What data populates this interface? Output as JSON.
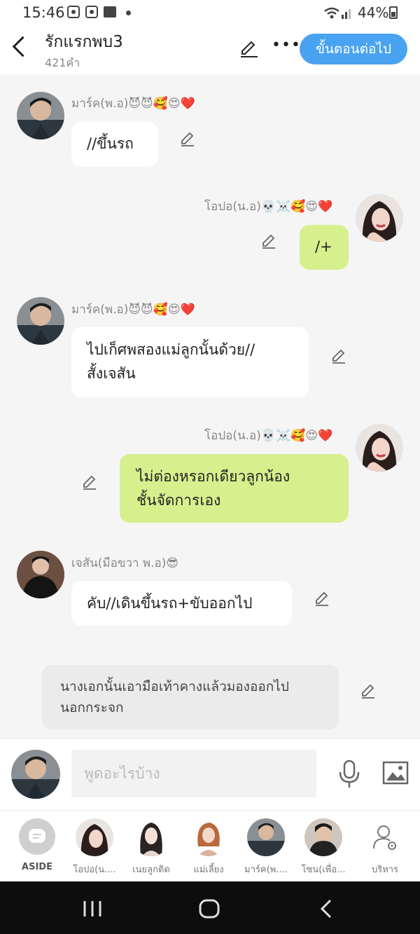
{
  "status_bar": {
    "time": "15:46",
    "battery": "44%"
  },
  "header": {
    "title": "รักแรกพบ3",
    "subtitle": "421คำ",
    "next_button": "ขั้นตอนต่อไป"
  },
  "messages": [
    {
      "sender": "มาร์ค(พ.อ)😈😈🥰😍❤️",
      "text": "//ขึ้นรถ",
      "side": "left"
    },
    {
      "sender": "โอปอ(น.อ)💀☠️🥰😍❤️",
      "text": "/+",
      "side": "right"
    },
    {
      "sender": "มาร์ค(พ.อ)😈😈🥰😍❤️",
      "text_lines": [
        "ไปเก็ศพสองแม่ลูกนั้นด้วย//",
        "สั้งเจสัน"
      ],
      "side": "left"
    },
    {
      "sender": "โอปอ(น.อ)💀☠️🥰😍❤️",
      "text_lines": [
        "ไม่ต่องหรอกเดียวลูกน้อง",
        "ชั้นจัดการเอง"
      ],
      "side": "right"
    },
    {
      "sender": "เจสัน(มือขวา พ.อ)😎",
      "text": "คับ//เดินขึ้นรถ+ขับออกไป",
      "side": "left"
    }
  ],
  "aside_message": {
    "lines": [
      "นางเอกนั้นเอามือเท้าคางแล้วมองออกไป",
      "นอกกระจก"
    ]
  },
  "input": {
    "placeholder": "พูดอะไรบ้าง"
  },
  "characters": [
    {
      "label": "ASIDE"
    },
    {
      "label": "โอปอ(น...."
    },
    {
      "label": "เนยลูกติด"
    },
    {
      "label": "แม่เลี้ยง"
    },
    {
      "label": "มาร์ค(พ...."
    },
    {
      "label": "โซน(เพื่อ..."
    },
    {
      "label": "บริหาร"
    }
  ],
  "colors": {
    "accent": "#4aa3f0",
    "my_bubble": "#d6f08e",
    "other_bubble": "#ffffff",
    "aside_bubble": "#ebebeb"
  }
}
